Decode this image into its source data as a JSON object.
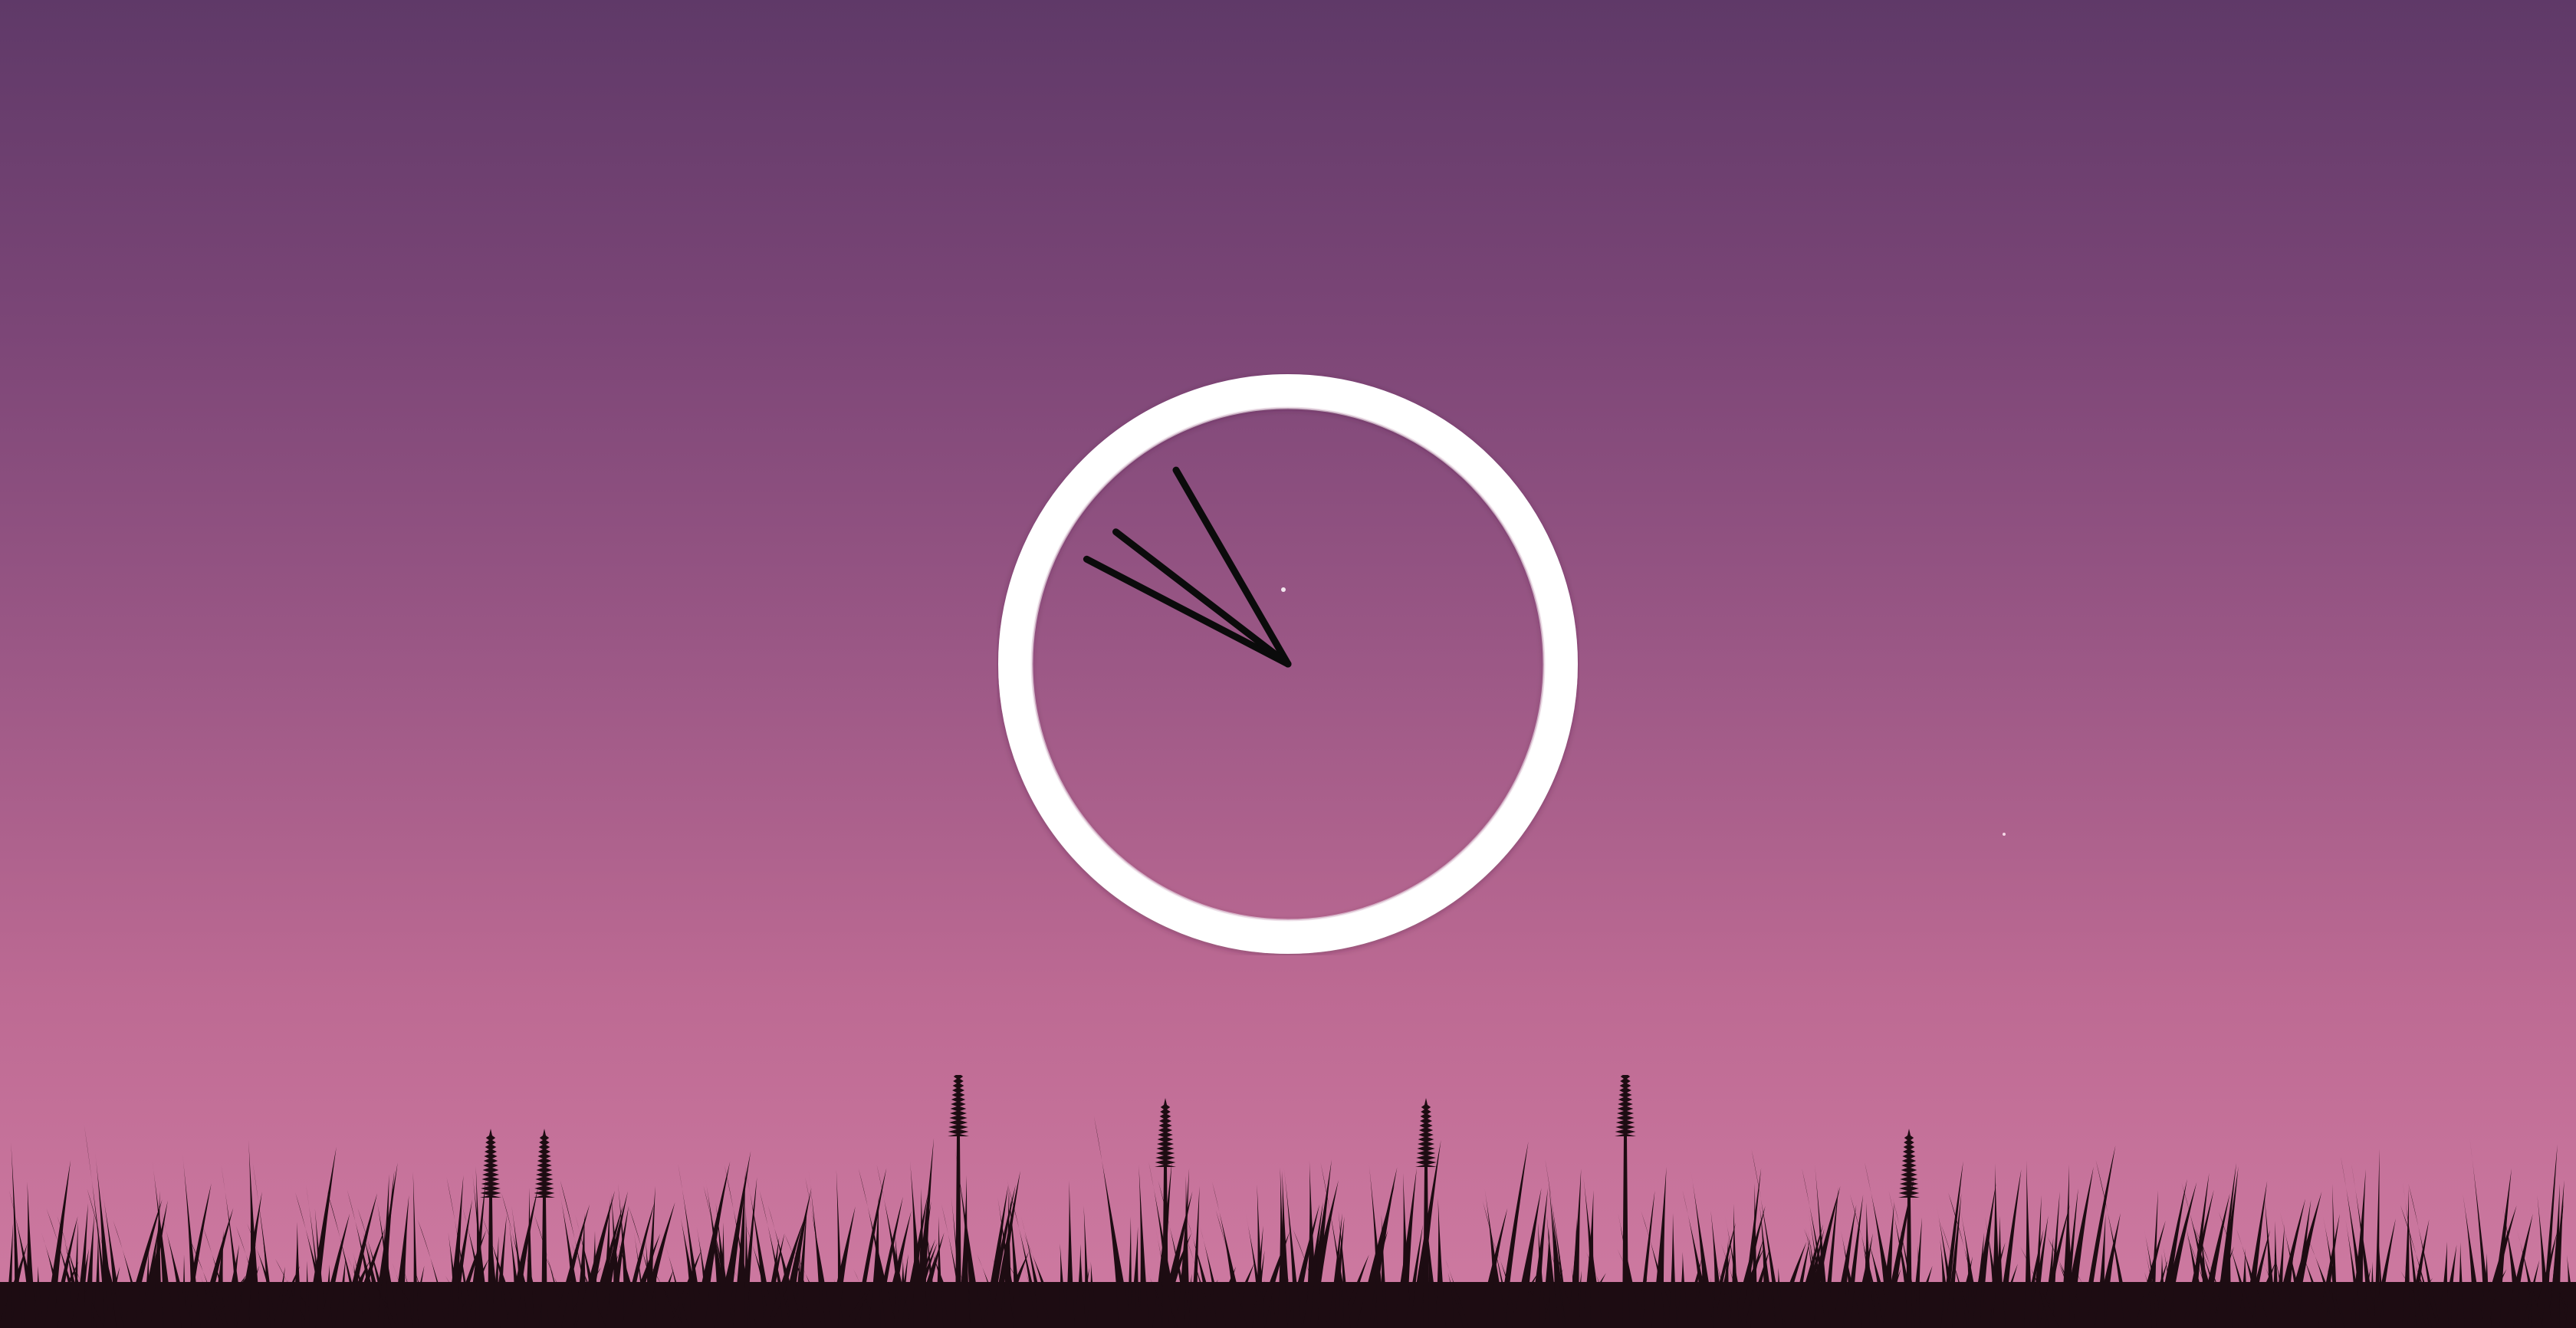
{
  "wallpaper": {
    "sky_colors": [
      "#5f3968",
      "#7c4677",
      "#9c5886",
      "#bd6a93",
      "#cf7ba2"
    ],
    "grass_color": "#1d0c12"
  },
  "clock": {
    "time": {
      "hours": 9,
      "minutes": 55
    },
    "ring_color": "#ffffff",
    "hand_color": "#0b0b0b"
  }
}
